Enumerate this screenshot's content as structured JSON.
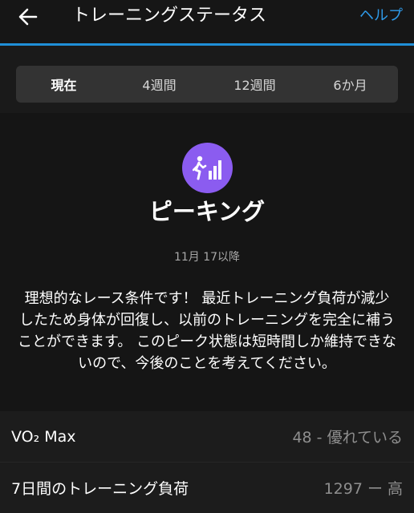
{
  "header": {
    "back_icon": "arrow-left-icon",
    "title": "トレーニングステータス",
    "help_label": "ヘルプ",
    "accent_color": "#1f8fd8"
  },
  "tabs": [
    {
      "label": "現在",
      "active": true
    },
    {
      "label": "4週間",
      "active": false
    },
    {
      "label": "12週間",
      "active": false
    },
    {
      "label": "6か月",
      "active": false
    }
  ],
  "status": {
    "icon": "peaking-runner-icon",
    "icon_color": "#8b5cf0",
    "name": "ピーキング",
    "date": "11月 17以降",
    "description": "理想的なレース条件です！ 最近トレーニング負荷が減少したため身体が回復し、以前のトレーニングを完全に補うことができます。 このピーク状態は短時間しか維持できないので、今後のことを考えてください。"
  },
  "metrics": [
    {
      "label": "VO₂ Max",
      "value": "48 - 優れている"
    },
    {
      "label": "7日間のトレーニング負荷",
      "value": "1297 ー 高"
    }
  ]
}
